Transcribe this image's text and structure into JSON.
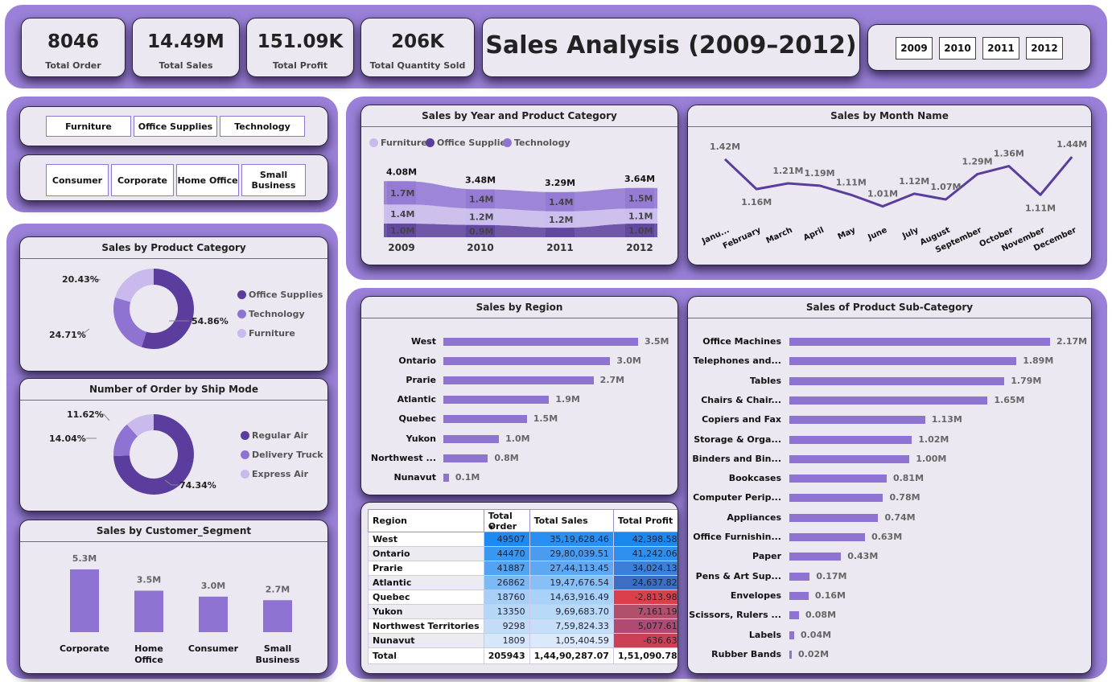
{
  "kpis": [
    {
      "value": "8046",
      "label": "Total Order"
    },
    {
      "value": "14.49M",
      "label": "Total Sales"
    },
    {
      "value": "151.09K",
      "label": "Total Profit"
    },
    {
      "value": "206K",
      "label": "Total Quantity Sold"
    }
  ],
  "title": "Sales Analysis (2009–2012)",
  "year_slicer": [
    "2009",
    "2010",
    "2011",
    "2012"
  ],
  "category_slicer": [
    "Furniture",
    "Office Supplies",
    "Technology"
  ],
  "segment_slicer": [
    "Consumer",
    "Corporate",
    "Home Office",
    "Small Business"
  ],
  "colors": {
    "dark": "#5a3d9c",
    "mid": "#8f73d3",
    "light": "#c9b9ec",
    "band": "#9a80d8"
  },
  "year_category": {
    "title": "Sales by Year and Product Category",
    "legend": [
      "Furniture",
      "Office Supplies",
      "Technology"
    ],
    "chart_data": {
      "type": "area",
      "categories": [
        "2009",
        "2010",
        "2011",
        "2012"
      ],
      "totals": [
        "4.08M",
        "3.48M",
        "3.29M",
        "3.64M"
      ],
      "series": [
        {
          "name": "Technology",
          "values": [
            1.7,
            1.4,
            1.4,
            1.5
          ],
          "labels": [
            "1.7M",
            "1.4M",
            "1.4M",
            "1.5M"
          ]
        },
        {
          "name": "Furniture",
          "values": [
            1.4,
            1.2,
            1.2,
            1.1
          ],
          "labels": [
            "1.4M",
            "1.2M",
            "1.2M",
            "1.1M"
          ]
        },
        {
          "name": "Office Supplies",
          "values": [
            1.0,
            0.9,
            0.7,
            1.0
          ],
          "labels": [
            "1.0M",
            "0.9M",
            "",
            "1.0M"
          ]
        }
      ]
    }
  },
  "month": {
    "title": "Sales by Month Name",
    "chart_data": {
      "type": "line",
      "categories": [
        "Janu...",
        "February",
        "March",
        "April",
        "May",
        "June",
        "July",
        "August",
        "September",
        "October",
        "November",
        "December"
      ],
      "values": [
        1.42,
        1.16,
        1.21,
        1.19,
        1.11,
        1.01,
        1.12,
        1.07,
        1.29,
        1.36,
        1.11,
        1.44
      ],
      "labels": [
        "1.42M",
        "1.16M",
        "1.21M",
        "1.19M",
        "1.11M",
        "1.01M",
        "1.12M",
        "1.07M",
        "1.29M",
        "1.36M",
        "1.11M",
        "1.44M"
      ]
    }
  },
  "product_category": {
    "title": "Sales by Product Category",
    "chart_data": {
      "type": "pie",
      "categories": [
        "Office Supplies",
        "Technology",
        "Furniture"
      ],
      "values": [
        54.86,
        24.71,
        20.43
      ],
      "labels": [
        "54.86%",
        "24.71%",
        "20.43%"
      ]
    }
  },
  "ship_mode": {
    "title": "Number of Order by Ship Mode",
    "chart_data": {
      "type": "pie",
      "categories": [
        "Regular Air",
        "Delivery Truck",
        "Express Air"
      ],
      "values": [
        74.34,
        14.04,
        11.62
      ],
      "labels": [
        "74.34%",
        "14.04%",
        "11.62%"
      ]
    }
  },
  "customer_segment": {
    "title": "Sales by Customer_Segment",
    "chart_data": {
      "type": "bar",
      "categories": [
        "Corporate",
        "Home Office",
        "Consumer",
        "Small Business"
      ],
      "values": [
        5.3,
        3.5,
        3.0,
        2.7
      ],
      "labels": [
        "5.3M",
        "3.5M",
        "3.0M",
        "2.7M"
      ]
    }
  },
  "region": {
    "title": "Sales by Region",
    "chart_data": {
      "type": "bar",
      "categories": [
        "West",
        "Ontario",
        "Prarie",
        "Atlantic",
        "Quebec",
        "Yukon",
        "Northwest ...",
        "Nunavut"
      ],
      "values": [
        3.5,
        3.0,
        2.7,
        1.9,
        1.5,
        1.0,
        0.8,
        0.1
      ],
      "labels": [
        "3.5M",
        "3.0M",
        "2.7M",
        "1.9M",
        "1.5M",
        "1.0M",
        "0.8M",
        "0.1M"
      ]
    }
  },
  "subcategory": {
    "title": "Sales of Product Sub-Category",
    "chart_data": {
      "type": "bar",
      "categories": [
        "Office Machines",
        "Telephones and...",
        "Tables",
        "Chairs & Chair...",
        "Copiers and Fax",
        "Storage & Orga...",
        "Binders and Bin...",
        "Bookcases",
        "Computer Perip...",
        "Appliances",
        "Office Furnishin...",
        "Paper",
        "Pens & Art Sup...",
        "Envelopes",
        "Scissors, Rulers ...",
        "Labels",
        "Rubber Bands"
      ],
      "values": [
        2.17,
        1.89,
        1.79,
        1.65,
        1.13,
        1.02,
        1.0,
        0.81,
        0.78,
        0.74,
        0.63,
        0.43,
        0.17,
        0.16,
        0.08,
        0.04,
        0.02
      ],
      "labels": [
        "2.17M",
        "1.89M",
        "1.79M",
        "1.65M",
        "1.13M",
        "1.02M",
        "1.00M",
        "0.81M",
        "0.78M",
        "0.74M",
        "0.63M",
        "0.43M",
        "0.17M",
        "0.16M",
        "0.08M",
        "0.04M",
        "0.02M"
      ]
    }
  },
  "table": {
    "headers": [
      "Region",
      "Total Order",
      "Total Sales",
      "Total Profit"
    ],
    "rows": [
      [
        "West",
        "49507",
        "35,19,628.46",
        "42,398.58"
      ],
      [
        "Ontario",
        "44470",
        "29,80,039.51",
        "41,242.06"
      ],
      [
        "Prarie",
        "41887",
        "27,44,113.45",
        "34,024.13"
      ],
      [
        "Atlantic",
        "26862",
        "19,47,676.54",
        "24,637.82"
      ],
      [
        "Quebec",
        "18760",
        "14,63,916.49",
        "-2,813.98"
      ],
      [
        "Yukon",
        "13350",
        "9,69,683.70",
        "7,161.19"
      ],
      [
        "Northwest Territories",
        "9298",
        "7,59,824.33",
        "5,077.61"
      ],
      [
        "Nunavut",
        "1809",
        "1,05,404.59",
        "-636.63"
      ]
    ],
    "total": [
      "Total",
      "205943",
      "1,44,90,287.07",
      "1,51,090.78"
    ],
    "order_colors": [
      "#1e8af0",
      "#3a97f0",
      "#52a3f2",
      "#7dbaf4",
      "#a8d0f7",
      "#b6d7f8",
      "#c3ddf9",
      "#d6e7fb"
    ],
    "sales_colors": [
      "#2b8ff0",
      "#4a9cf1",
      "#5ea7f2",
      "#88c0f5",
      "#aad1f7",
      "#b9d9f8",
      "#c5dff9",
      "#dce9fb"
    ],
    "profit_colors": [
      "#1c87ee",
      "#2d8fee",
      "#3c7fd8",
      "#3c6fc4",
      "#d9404a",
      "#b0506a",
      "#b04a70",
      "#cc4055"
    ]
  }
}
